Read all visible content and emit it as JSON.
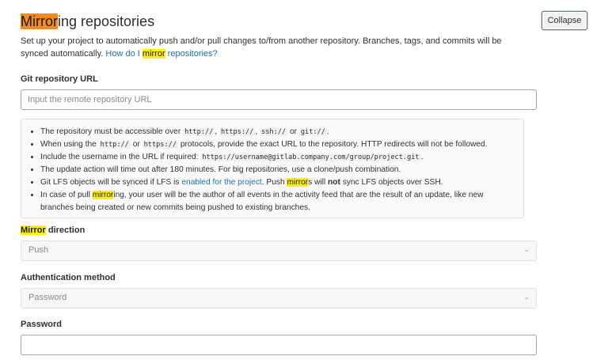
{
  "header": {
    "title_highlight": "Mirror",
    "title_rest": "ing repositories",
    "collapse_label": "Collapse"
  },
  "description": {
    "text": "Set up your project to automatically push and/or pull changes to/from another repository. Branches, tags, and commits will be synced automatically.",
    "link_pre": "How do I",
    "link_highlight": "mirror",
    "link_post": "repositories?"
  },
  "git_url": {
    "label": "Git repository URL",
    "placeholder": "Input the remote repository URL",
    "value": ""
  },
  "info": {
    "item1": {
      "a": "The repository must be accessible over",
      "c1": "http://",
      "c2": "https://",
      "c3": "ssh://",
      "or": "or",
      "c4": "git://"
    },
    "item2": {
      "a": "When using the",
      "c1": "http://",
      "or": "or",
      "c2": "https://",
      "b": "protocols, provide the exact URL to the repository. HTTP redirects will not be followed."
    },
    "item3": {
      "a": "Include the username in the URL if required:",
      "c1": "https://username@gitlab.company.com/group/project.git"
    },
    "item4": {
      "a": "The update action will time out after 180 minutes. For big repositories, use a clone/push combination."
    },
    "item5": {
      "a": "Git LFS objects will be synced if LFS is",
      "link": "enabled for the project",
      "b": ". Push",
      "hl": "mirror",
      "c": "s will",
      "strong": "not",
      "d": "sync LFS objects over SSH."
    },
    "item6": {
      "a": "In case of pull",
      "hl": "mirror",
      "b": "ing, your user will be the author of all events in the activity feed that are the result of an update, like new branches being created or new commits being pushed to existing branches."
    }
  },
  "direction": {
    "label_highlight": "Mirror",
    "label_rest": " direction",
    "value": "Push"
  },
  "auth": {
    "label": "Authentication method",
    "value": "Password"
  },
  "password": {
    "label": "Password",
    "value": ""
  },
  "colors": {
    "title_highlight": "#f28c1e",
    "search_highlight": "#fff200",
    "link": "#1f6fb2"
  }
}
